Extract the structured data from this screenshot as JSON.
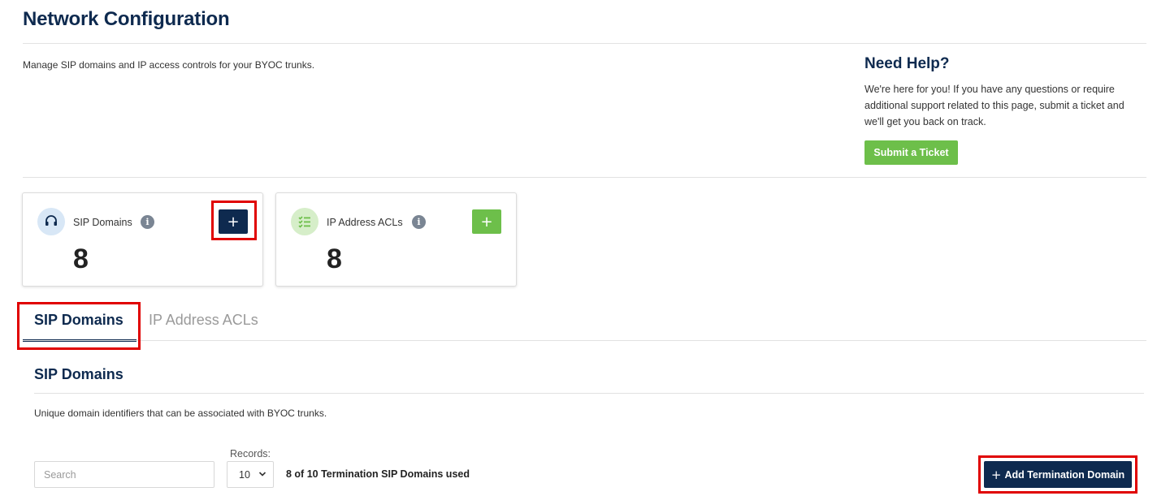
{
  "page": {
    "title": "Network Configuration",
    "description": "Manage SIP domains and IP access controls for your BYOC trunks."
  },
  "help": {
    "title": "Need Help?",
    "text": "We're here for you! If you have any questions or require additional support related to this page, submit a ticket and we'll get you back on track.",
    "button_label": "Submit a Ticket"
  },
  "cards": [
    {
      "label": "SIP Domains",
      "count": "8",
      "icon": "headset-icon",
      "info_icon": "info-icon",
      "add_icon": "plus-icon",
      "accent": "#0e2a4f"
    },
    {
      "label": "IP Address ACLs",
      "count": "8",
      "icon": "checklist-icon",
      "info_icon": "info-icon",
      "add_icon": "plus-icon",
      "accent": "#6dbf4a"
    }
  ],
  "tabs": [
    {
      "label": "SIP Domains",
      "active": true
    },
    {
      "label": "IP Address ACLs",
      "active": false
    }
  ],
  "section": {
    "title": "SIP Domains",
    "description": "Unique domain identifiers that can be associated with BYOC trunks."
  },
  "controls": {
    "search_placeholder": "Search",
    "records_label": "Records:",
    "records_value": "10",
    "usage_text": "8 of 10 Termination SIP Domains used",
    "add_button_plus": "+",
    "add_button_label": "Add Termination Domain"
  },
  "colors": {
    "brand_navy": "#0e2a4f",
    "accent_green": "#6dbf4a",
    "highlight_red": "#e00000"
  }
}
